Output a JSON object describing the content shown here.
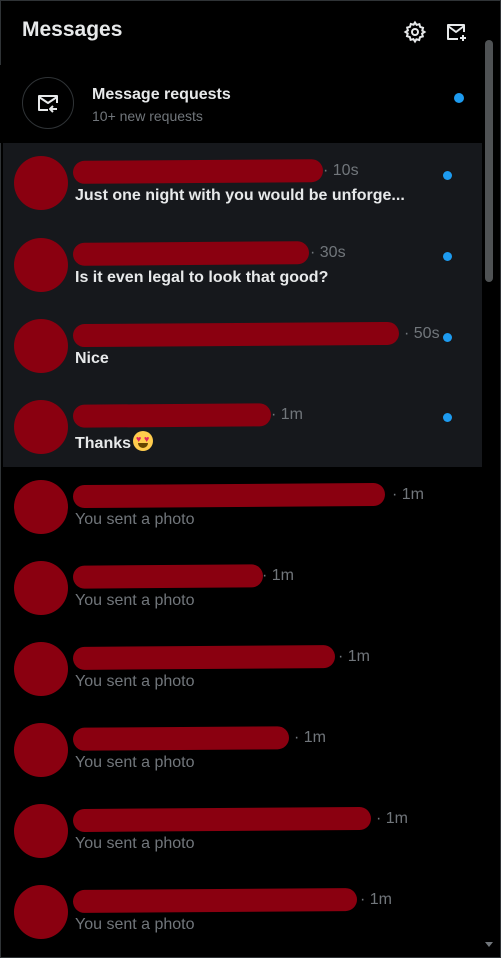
{
  "header": {
    "title": "Messages",
    "settings_icon": "gear-icon",
    "new_message_icon": "new-message-icon"
  },
  "requests": {
    "title": "Message requests",
    "subtitle": "10+ new requests",
    "icon": "message-request-icon",
    "unread": true
  },
  "colors": {
    "background": "#000000",
    "unread_background": "#16181c",
    "accent_blue": "#1d9bf0",
    "redaction": "#8a0010",
    "text_primary": "#e7e9ea",
    "text_secondary": "#71767b"
  },
  "conversations": [
    {
      "time": "10s",
      "preview": "Just one night with you would be unforge...",
      "unread": true,
      "name_redacted": true
    },
    {
      "time": "30s",
      "preview": "Is it even legal to look that good?",
      "unread": true,
      "name_redacted": true
    },
    {
      "time": "50s",
      "preview": "Nice",
      "unread": true,
      "name_redacted": true
    },
    {
      "time": "1m",
      "preview": "Thanks",
      "unread": true,
      "name_redacted": true,
      "emoji": "heart-eyes-emoji"
    },
    {
      "time": "1m",
      "preview": "You sent a photo",
      "unread": false,
      "name_redacted": true
    },
    {
      "time": "1m",
      "preview": "You sent a photo",
      "unread": false,
      "name_redacted": true
    },
    {
      "time": "1m",
      "preview": "You sent a photo",
      "unread": false,
      "name_redacted": true
    },
    {
      "time": "1m",
      "preview": "You sent a photo",
      "unread": false,
      "name_redacted": true
    },
    {
      "time": "1m",
      "preview": "You sent a photo",
      "unread": false,
      "name_redacted": true
    },
    {
      "time": "1m",
      "preview": "You sent a photo",
      "unread": false,
      "name_redacted": true
    }
  ]
}
